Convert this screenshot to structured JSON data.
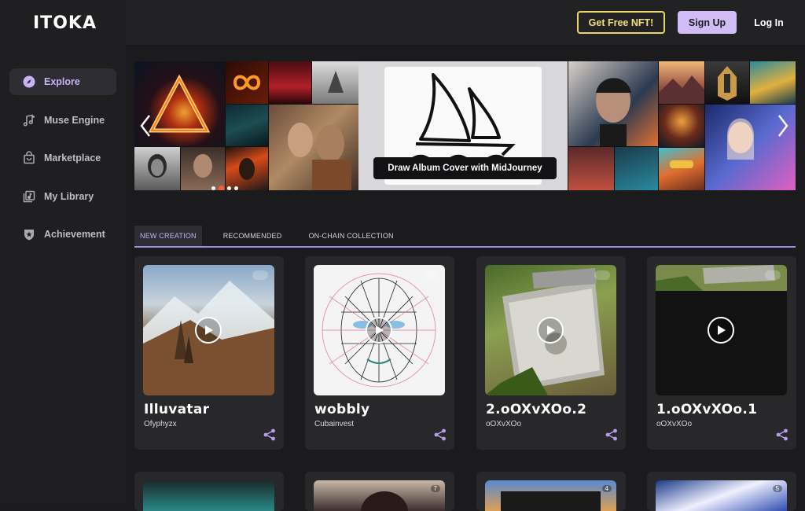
{
  "app": {
    "logo": "ITOKA"
  },
  "sidebar": {
    "items": [
      {
        "label": "Explore",
        "icon": "compass-icon",
        "active": true
      },
      {
        "label": "Muse Engine",
        "icon": "music-note-icon"
      },
      {
        "label": "Marketplace",
        "icon": "shopping-bag-icon"
      },
      {
        "label": "My Library",
        "icon": "library-icon"
      },
      {
        "label": "Achievement",
        "icon": "shield-badge-icon"
      }
    ]
  },
  "header": {
    "nft_label": "Get Free NFT!",
    "signup_label": "Sign Up",
    "login_label": "Log In"
  },
  "banner": {
    "caption": "Draw Album Cover with MidJourney",
    "slide_count": 4,
    "active_slide": 1
  },
  "tabs": [
    {
      "label": "NEW CREATION",
      "active": true
    },
    {
      "label": "RECOMMENDED"
    },
    {
      "label": "ON-CHAIN COLLECTION"
    }
  ],
  "cards": [
    {
      "title": "Illuvatar",
      "author": "Ofyphyzx"
    },
    {
      "title": "wobbly",
      "author": "Cubainvest"
    },
    {
      "title": "2.oOXvXOo.2",
      "author": "oOXvXOo"
    },
    {
      "title": "1.oOXvXOo.1",
      "author": "oOXvXOo"
    }
  ],
  "cards_row2": [
    {
      "badge": ""
    },
    {
      "badge": "7"
    },
    {
      "badge": "4"
    },
    {
      "badge": "5"
    }
  ],
  "colors": {
    "accent": "#c7b2f5",
    "nft_yellow": "#e8d86a",
    "signup_bg": "#d2bcf6",
    "dot_active": "#ff5a2e"
  }
}
